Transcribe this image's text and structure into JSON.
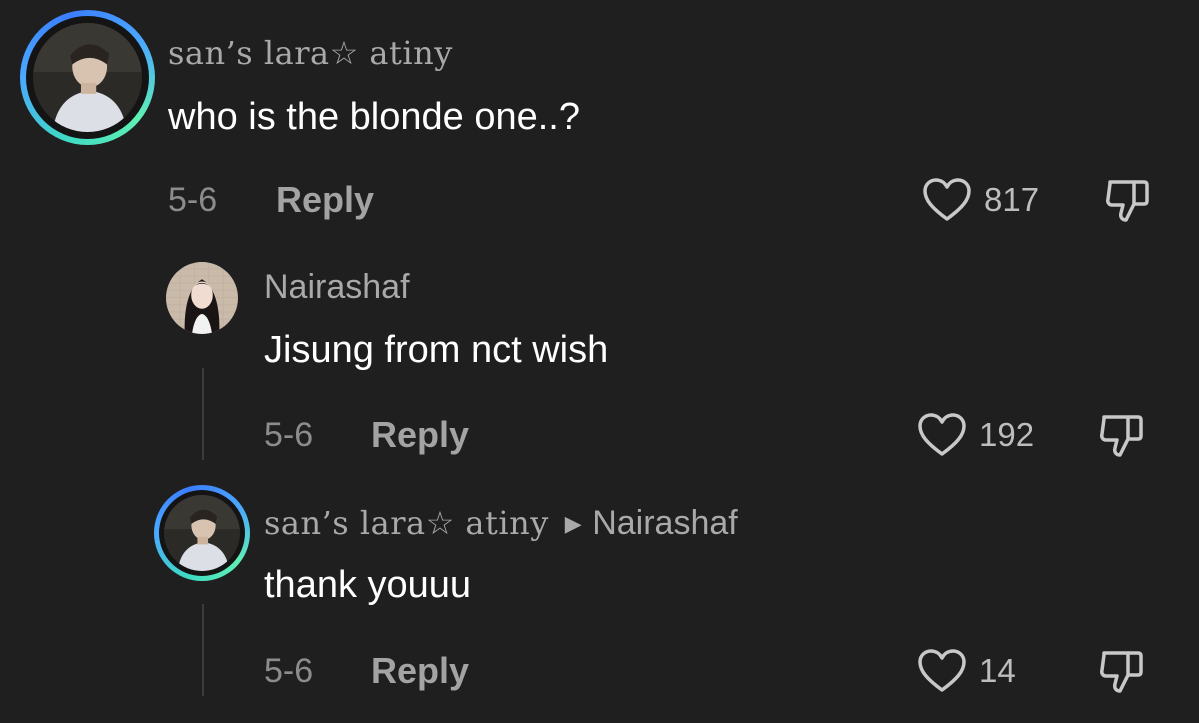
{
  "comments": [
    {
      "username": "san’s lara☆ atiny",
      "text": "who is the blonde one..?",
      "date": "5-6",
      "reply_label": "Reply",
      "likes": "817"
    },
    {
      "username": "Nairashaf",
      "text": "Jisung from nct wish",
      "date": "5-6",
      "reply_label": "Reply",
      "likes": "192"
    },
    {
      "username": "san’s lara☆ atiny",
      "reply_to": "Nairashaf",
      "text": "thank youuu",
      "date": "5-6",
      "reply_label": "Reply",
      "likes": "14"
    }
  ],
  "icons": {
    "like": "heart-outline-icon",
    "dislike": "thumbs-down-outline-icon",
    "reply_arrow": "triangle-right-icon"
  },
  "colors": {
    "background": "#1f1f1f",
    "text": "#ffffff",
    "muted": "#8c8c8c",
    "avatar_ring_start": "#3fd9c4",
    "avatar_ring_end": "#4aa8ff"
  }
}
